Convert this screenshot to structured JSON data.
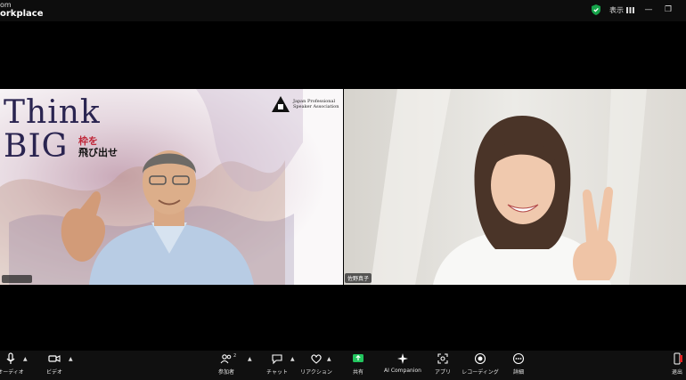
{
  "titlebar": {
    "brand_line1": "om",
    "brand_line2": "orkplace",
    "view_label": "表示",
    "minimize": "—",
    "restore": "❐"
  },
  "stage": {
    "left_tile": {
      "slide_title_1": "Think",
      "slide_title_2": "BIG",
      "slogan_line1": "枠を",
      "slogan_line2": "飛び出せ",
      "association_line1": "Japan Professional",
      "association_line2": "Speaker Association",
      "participant_name": ""
    },
    "right_tile": {
      "participant_name": "佐野真子"
    }
  },
  "toolbar": {
    "audio": "オーディオ",
    "video": "ビデオ",
    "participants": "参加者",
    "participants_count": "2",
    "chat": "チャット",
    "reactions": "リアクション",
    "share": "共有",
    "ai_companion": "AI Companion",
    "apps": "アプリ",
    "recording": "レコーディング",
    "more": "詳細",
    "leave": "退出"
  },
  "colors": {
    "share_green": "#22c55e",
    "leave_red": "#e02424",
    "shield_green": "#16a34a"
  }
}
